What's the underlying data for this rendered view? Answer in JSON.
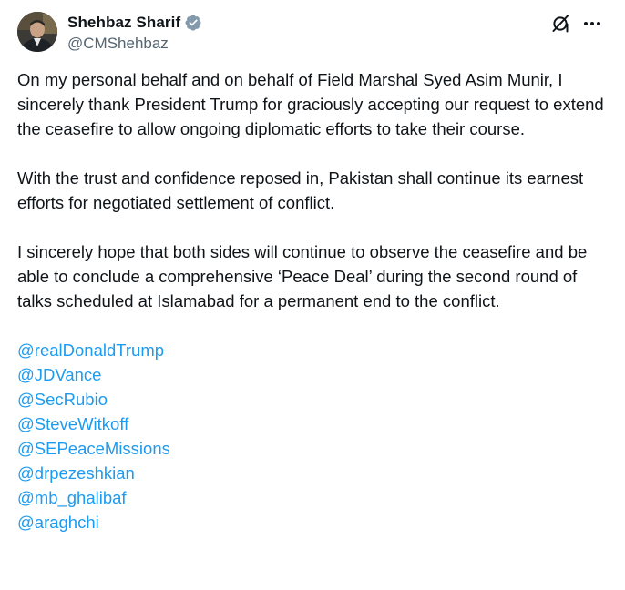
{
  "author": {
    "display_name": "Shehbaz Sharif",
    "handle": "@CMShehbaz",
    "verified_icon": "verified-badge-icon",
    "badge_color": "#829aab"
  },
  "actions": {
    "grok_icon": "grok-icon",
    "more_icon": "more-options-icon"
  },
  "tweet": {
    "paragraphs": [
      "On my personal behalf and on behalf of Field Marshal Syed Asim Munir, I sincerely thank President Trump for graciously accepting our request to extend the ceasefire to allow ongoing diplomatic efforts to take their course.",
      "With the trust and confidence reposed in, Pakistan shall continue its earnest efforts for negotiated settlement of conflict.",
      "I sincerely hope that both sides will continue to observe the ceasefire and be able to conclude a comprehensive ‘Peace Deal’ during the second round of talks scheduled at Islamabad for a permanent end to the conflict."
    ],
    "mentions": [
      "@realDonaldTrump",
      "@JDVance",
      "@SecRubio",
      "@SteveWitkoff",
      "@SEPeaceMissions",
      "@drpezeshkian",
      "@mb_ghalibaf",
      "@araghchi"
    ]
  },
  "colors": {
    "text": "#0f1419",
    "secondary": "#536471",
    "link": "#1d9bf0"
  }
}
